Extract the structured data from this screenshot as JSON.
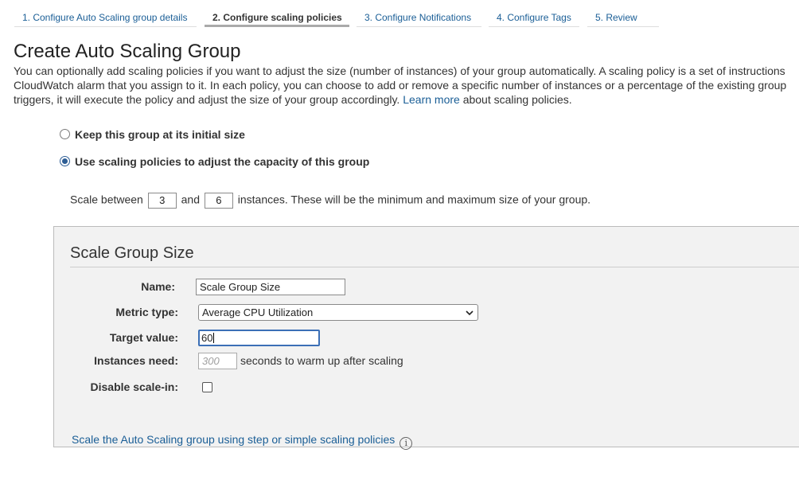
{
  "wizard": {
    "tabs": [
      {
        "label": "1. Configure Auto Scaling group details",
        "active": false
      },
      {
        "label": "2. Configure scaling policies",
        "active": true
      },
      {
        "label": "3. Configure Notifications",
        "active": false
      },
      {
        "label": "4. Configure Tags",
        "active": false
      },
      {
        "label": "5. Review",
        "active": false
      }
    ]
  },
  "page": {
    "title": "Create Auto Scaling Group",
    "intro_line1": "You can optionally add scaling policies if you want to adjust the size (number of instances) of your group automatically. A scaling policy is a set of instructions",
    "intro_line2": "CloudWatch alarm that you assign to it. In each policy, you can choose to add or remove a specific number of instances or a percentage of the existing group",
    "intro_line3_pre": "triggers, it will execute the policy and adjust the size of your group accordingly.",
    "learn_more": "Learn more",
    "intro_line3_post": "about scaling policies."
  },
  "options": {
    "keep_size_label": "Keep this group at its initial size",
    "use_policies_label": "Use scaling policies to adjust the capacity of this group",
    "selected": "use_policies"
  },
  "scale_range": {
    "prefix": "Scale between",
    "min": "3",
    "conjunction": "and",
    "max": "6",
    "suffix": "instances. These will be the minimum and maximum size of your group."
  },
  "policy": {
    "heading": "Scale Group Size",
    "name_label": "Name:",
    "name_value": "Scale Group Size",
    "metric_label": "Metric type:",
    "metric_value": "Average CPU Utilization",
    "target_label": "Target value:",
    "target_value": "60",
    "warmup_label": "Instances need:",
    "warmup_placeholder": "300",
    "warmup_suffix": "seconds to warm up after scaling",
    "disable_label": "Disable scale-in:",
    "disable_checked": false,
    "step_link": "Scale the Auto Scaling group using step or simple scaling policies",
    "info_glyph": "i"
  },
  "colors": {
    "link": "#1a5e96",
    "panel_bg": "#f2f2f2",
    "focus_border": "#3b6fb6"
  },
  "icons": [
    "radio-unchecked",
    "radio-checked",
    "chevron-down-icon",
    "checkbox-icon",
    "info-icon"
  ]
}
